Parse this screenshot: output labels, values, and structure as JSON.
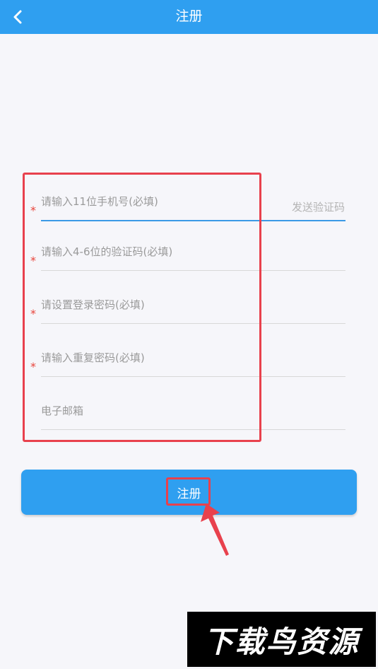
{
  "header": {
    "title": "注册",
    "back_icon": "chevron-left-icon"
  },
  "form": {
    "fields": [
      {
        "required": true,
        "required_mark": "*",
        "placeholder": "请输入11位手机号(必填)",
        "value": "",
        "action_label": "发送验证码"
      },
      {
        "required": true,
        "required_mark": "*",
        "placeholder": "请输入4-6位的验证码(必填)",
        "value": ""
      },
      {
        "required": true,
        "required_mark": "*",
        "placeholder": "请设置登录密码(必填)",
        "value": ""
      },
      {
        "required": true,
        "required_mark": "*",
        "placeholder": "请输入重复密码(必填)",
        "value": ""
      },
      {
        "required": false,
        "placeholder": "电子邮箱",
        "value": ""
      }
    ]
  },
  "register_button": {
    "label": "注册"
  },
  "watermark": {
    "text": "下载鸟资源"
  },
  "colors": {
    "primary": "#2f9ff0",
    "background": "#f6f6fa",
    "required_star": "#e8443a",
    "annotation": "#e8414d",
    "active_underline": "#3b9ae6",
    "placeholder_text": "#9a9a9a"
  }
}
